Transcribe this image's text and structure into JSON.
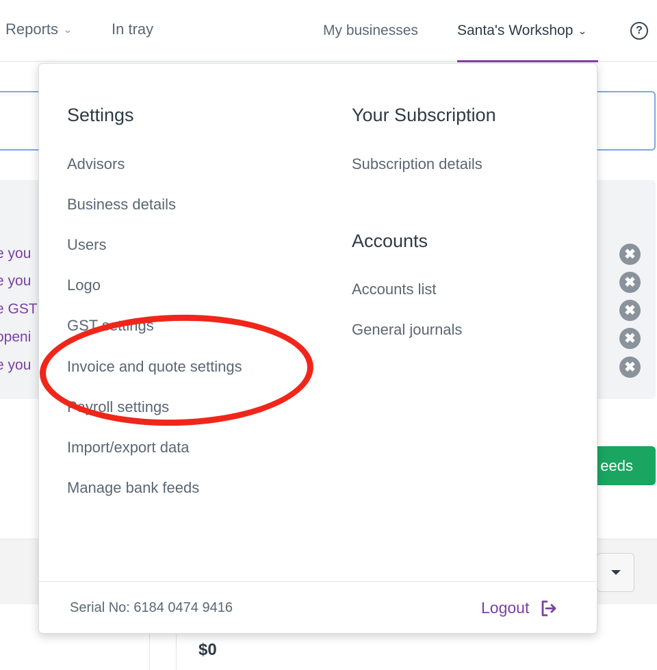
{
  "topnav": {
    "reports_label": "Reports",
    "intray_label": "In tray",
    "my_businesses_label": "My businesses",
    "business_name": "Santa's Workshop",
    "help_glyph": "?"
  },
  "background": {
    "notification_links": [
      "e you",
      "e you",
      "e GST",
      "openi",
      "e you"
    ],
    "dismiss_glyph": "✖",
    "feeds_button_label": "eeds",
    "amount": "$0"
  },
  "menu": {
    "settings": {
      "heading": "Settings",
      "items": [
        {
          "label": "Advisors"
        },
        {
          "label": "Business details"
        },
        {
          "label": "Users"
        },
        {
          "label": "Logo"
        },
        {
          "label": "GST settings"
        },
        {
          "label": "Invoice and quote settings"
        },
        {
          "label": "Payroll settings"
        },
        {
          "label": "Import/export data"
        },
        {
          "label": "Manage bank feeds"
        }
      ]
    },
    "subscription": {
      "heading": "Your Subscription",
      "items": [
        {
          "label": "Subscription details"
        }
      ]
    },
    "accounts": {
      "heading": "Accounts",
      "items": [
        {
          "label": "Accounts list"
        },
        {
          "label": "General journals"
        }
      ]
    },
    "footer": {
      "serial": "Serial No: 6184 0474 9416",
      "logout_label": "Logout"
    }
  },
  "colors": {
    "accent_purple": "#8241aa",
    "link_purple": "#7a3fa6",
    "success_green": "#1aa561",
    "annotation_red": "#f0261a"
  }
}
